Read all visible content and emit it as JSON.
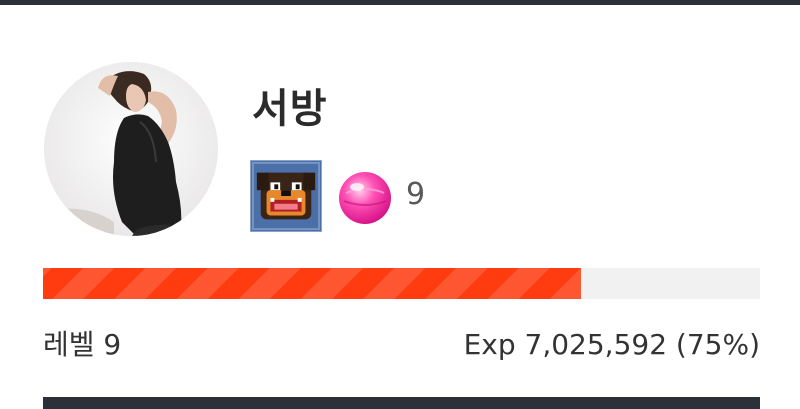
{
  "profile": {
    "nickname": "서방",
    "gem_count": "9",
    "level_text": "레벨 9",
    "exp_text": "Exp 7,025,592 (75%)",
    "exp_percent": 75,
    "avatar_icon": "profile-photo",
    "badge_icon": "dog-badge",
    "gem_icon": "pink-gem"
  },
  "colors": {
    "progress_fill": "#ff3b10",
    "progress_track": "#f1f1f1",
    "dark_bar": "#2c3038"
  }
}
